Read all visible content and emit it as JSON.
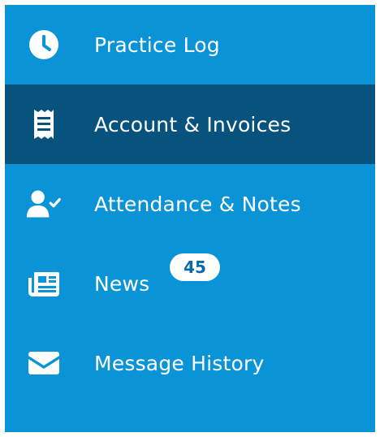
{
  "colors": {
    "sidebar_background": "#0a93d6",
    "active_background": "#08537e",
    "text": "#ffffff",
    "badge_background": "#ffffff",
    "badge_text": "#0a6aa8"
  },
  "menu": {
    "items": [
      {
        "label": "Practice Log",
        "icon": "clock-icon",
        "active": false
      },
      {
        "label": "Account & Invoices",
        "icon": "receipt-icon",
        "active": true
      },
      {
        "label": "Attendance & Notes",
        "icon": "user-check-icon",
        "active": false
      },
      {
        "label": "News",
        "icon": "newspaper-icon",
        "active": false,
        "badge": "45"
      },
      {
        "label": "Message History",
        "icon": "envelope-icon",
        "active": false
      }
    ]
  }
}
